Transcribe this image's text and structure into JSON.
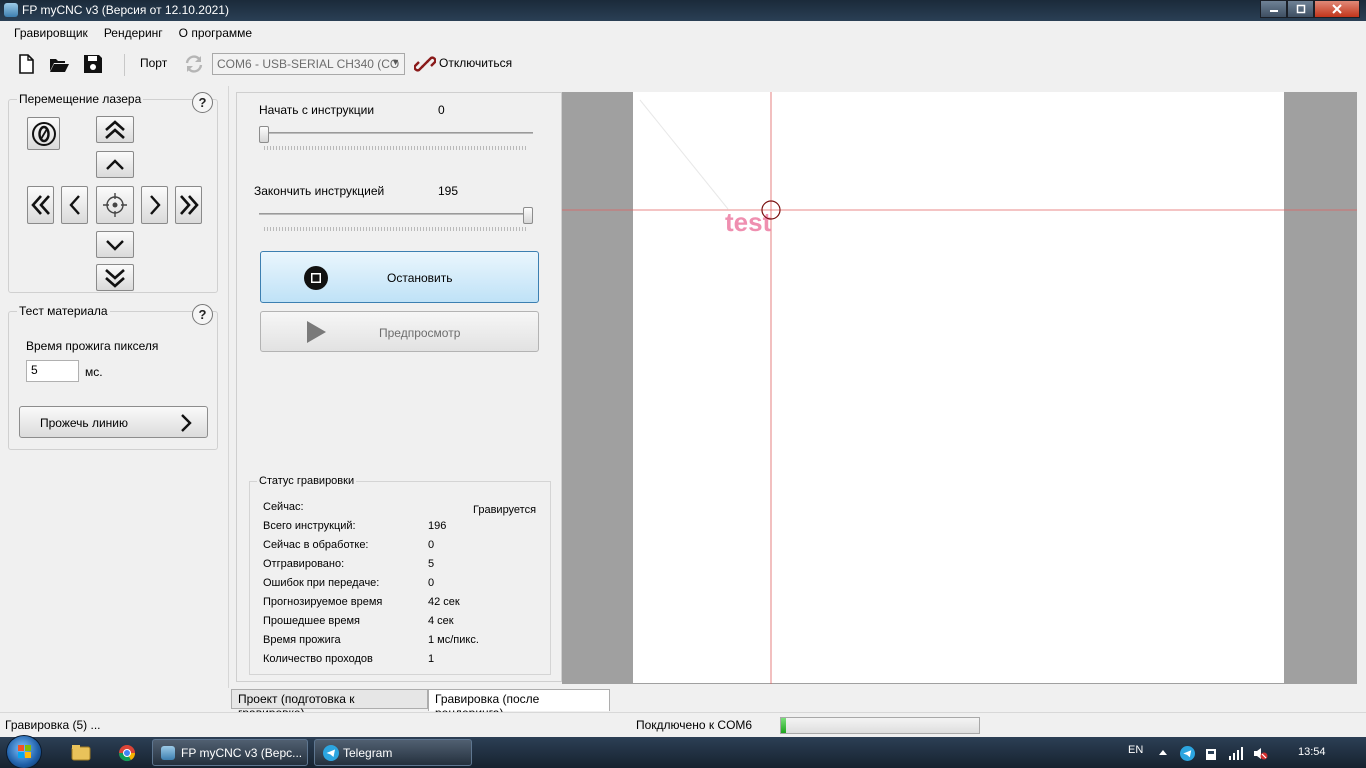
{
  "window": {
    "title": "FP myCNC v3 (Версия от 12.10.2021)"
  },
  "menu": [
    "Гравировщик",
    "Рендеринг",
    "О программе"
  ],
  "toolbar": {
    "port_label": "Порт",
    "port_value": "COM6 - USB-SERIAL CH340 (CO",
    "disconnect_label": "Отключиться"
  },
  "laser_move": {
    "title": "Перемещение лазера",
    "help": "?"
  },
  "material_test": {
    "title": "Тест материала",
    "help": "?",
    "burn_time_label": "Время прожига пикселя",
    "burn_time_value": "5",
    "unit": "мс.",
    "burn_line_label": "Прожечь линию"
  },
  "instructions": {
    "start_label": "Начать с инструкции",
    "start_value": "0",
    "end_label": "Закончить инструкцией",
    "end_value": "195",
    "start_fraction": 0,
    "end_fraction": 1
  },
  "actions": {
    "stop_label": "Остановить",
    "preview_label": "Предпросмотр"
  },
  "status": {
    "title": "Статус гравировки",
    "now_label": "Сейчас:",
    "now_value": "Гравируется",
    "rows": [
      {
        "label": "Всего инструкций:",
        "value": "196"
      },
      {
        "label": "Сейчас в обработке:",
        "value": "0"
      },
      {
        "label": "Отгравировано:",
        "value": "5"
      },
      {
        "label": "Ошибок при передаче:",
        "value": "0"
      },
      {
        "label": "Прогнозируемое время",
        "value": "42 сек"
      },
      {
        "label": "Прошедшее время",
        "value": "4 сек"
      },
      {
        "label": "Время прожига",
        "value": "1 мс/пикс."
      },
      {
        "label": "Количество проходов",
        "value": "1"
      }
    ]
  },
  "canvas": {
    "text": "test",
    "text_color": "#ef8fb0",
    "crosshair_color": "#e06060"
  },
  "tabs": {
    "project": "Проект (подготовка к гравировке)",
    "engraving": "Гравировка (после рендеринга)"
  },
  "statusbar": {
    "left": "Гравировка (5) ...",
    "connection": "Покдлючено к COM6",
    "progress_fraction": 0.025
  },
  "taskbar": {
    "task1": "FP myCNC v3 (Верс...",
    "task2": "Telegram",
    "lang": "EN",
    "clock": "13:54"
  }
}
